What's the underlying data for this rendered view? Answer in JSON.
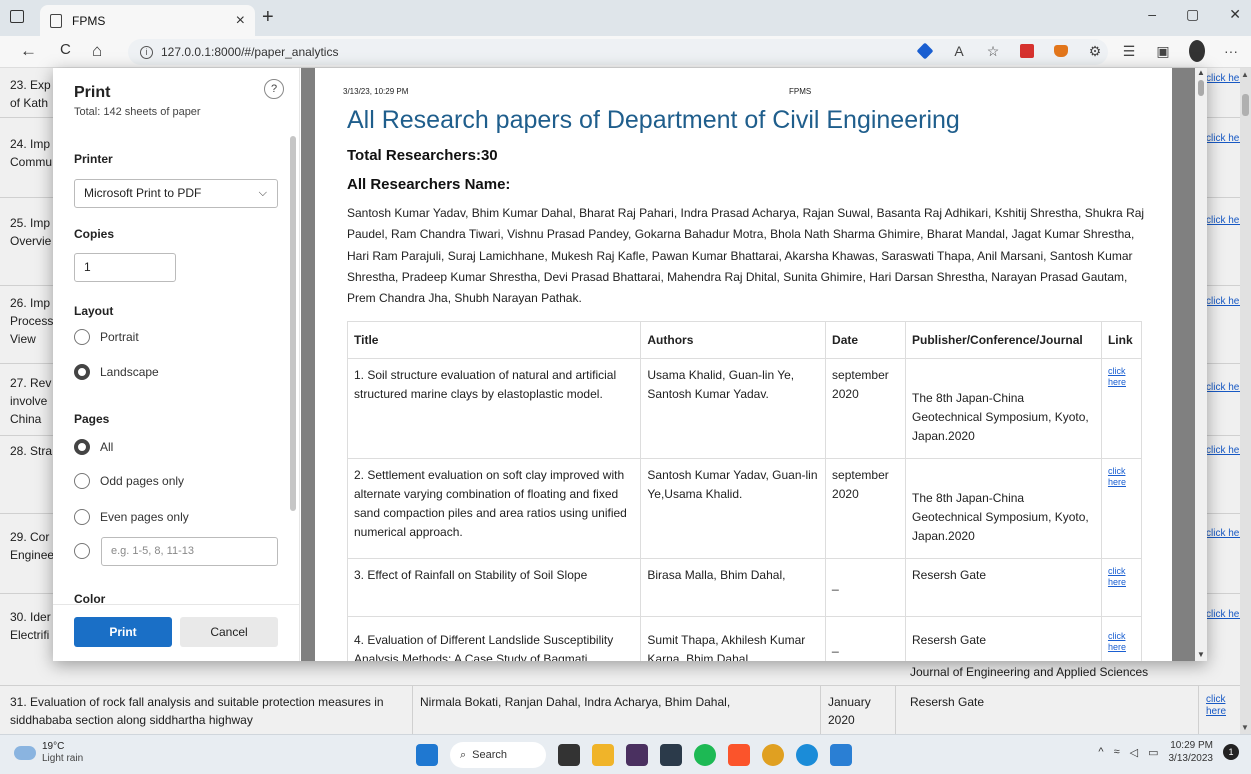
{
  "browser": {
    "tab_title": "FPMS",
    "tab_close": "×",
    "new_tab": "+",
    "url": "127.0.0.1:8000/#/paper_analytics",
    "back": "←",
    "refresh": "C",
    "home": "⌂",
    "win_min": "–",
    "win_max": "▢",
    "win_close": "✕",
    "more": "···"
  },
  "background_rows": [
    {
      "text": "23. Exp\nof Kath"
    },
    {
      "text": "24. Imp\nCommu"
    },
    {
      "text": "25. Imp\nOvervie"
    },
    {
      "text": "26. Imp\nProcess\nView"
    },
    {
      "text": "27. Rev\ninvolve\nChina"
    },
    {
      "text": "28. Stra"
    },
    {
      "text": "29. Cor\nEnginee"
    },
    {
      "text": "30. Ider\nElectrifi"
    }
  ],
  "background_link": "click here",
  "background_bottom_row": {
    "title": "31. Evaluation of rock fall analysis and suitable protection measures in siddhababa section along siddhartha highway",
    "authors": "Nirmala Bokati, Ranjan Dahal, Indra Acharya, Bhim Dahal,",
    "date": "January 2020",
    "publisher": "Resersh Gate",
    "link": "click here",
    "peek_text": "Journal of Engineering and Applied Sciences"
  },
  "print_dialog": {
    "title": "Print",
    "sheets": "Total: 142 sheets of paper",
    "help": "?",
    "printer_label": "Printer",
    "printer_value": "Microsoft Print to PDF",
    "copies_label": "Copies",
    "copies_value": "1",
    "layout_label": "Layout",
    "layout_options": [
      "Portrait",
      "Landscape"
    ],
    "layout_selected": "Landscape",
    "pages_label": "Pages",
    "pages_options": [
      "All",
      "Odd pages only",
      "Even pages only"
    ],
    "pages_selected": "All",
    "pages_range_placeholder": "e.g. 1-5, 8, 11-13",
    "color_label": "Color",
    "print_button": "Print",
    "cancel_button": "Cancel"
  },
  "preview": {
    "header_date": "3/13/23, 10:29 PM",
    "header_title": "FPMS",
    "heading": "All Research papers of Department of Civil Engineering",
    "total_researchers": "Total Researchers:30",
    "names_heading": "All Researchers Name:",
    "names": "Santosh Kumar Yadav, Bhim Kumar Dahal, Bharat Raj Pahari, Indra Prasad Acharya, Rajan Suwal, Basanta Raj Adhikari, Kshitij Shrestha, Shukra Raj Paudel, Ram Chandra Tiwari, Vishnu Prasad Pandey, Gokarna Bahadur Motra, Bhola Nath Sharma Ghimire, Bharat Mandal, Jagat Kumar Shrestha, Hari Ram Parajuli, Suraj Lamichhane, Mukesh Raj Kafle, Pawan Kumar Bhattarai, Akarsha Khawas, Saraswati Thapa, Anil Marsani, Santosh Kumar Shrestha, Pradeep Kumar Shrestha, Devi Prasad Bhattarai, Mahendra Raj Dhital, Sunita Ghimire, Hari Darsan Shrestha, Narayan Prasad Gautam, Prem Chandra Jha, Shubh Narayan Pathak.",
    "table_headers": [
      "Title",
      "Authors",
      "Date",
      "Publisher/Conference/Journal",
      "Link"
    ],
    "rows": [
      {
        "title": "1. Soil structure evaluation of natural and artificial structured marine clays by elastoplastic model.",
        "authors": "Usama Khalid, Guan-lin Ye, Santosh Kumar Yadav.",
        "date": "september 2020",
        "publisher": "The 8th Japan-China Geotechnical Symposium, Kyoto, Japan.2020",
        "link": "click here"
      },
      {
        "title": "2. Settlement evaluation on soft clay improved with alternate varying combination of floating and fixed sand compaction piles and area ratios using unified numerical approach.",
        "authors": "Santosh Kumar Yadav, Guan-lin Ye,Usama Khalid.",
        "date": "september 2020",
        "publisher": "The 8th Japan-China Geotechnical Symposium, Kyoto, Japan.2020",
        "link": "click here"
      },
      {
        "title": "3. Effect of Rainfall on Stability of Soil Slope",
        "authors": "Birasa Malla, Bhim Dahal,",
        "date": "_",
        "publisher": "Resersh Gate",
        "link": "click here"
      },
      {
        "title": "4. Evaluation of Different Landslide Susceptibility Analysis Methods: A Case Study of Bagmati",
        "authors": "Sumit Thapa, Akhilesh Kumar Karna, Bhim Dahal",
        "date": "_",
        "publisher": "Resersh Gate",
        "link": "click here"
      }
    ]
  },
  "taskbar": {
    "temp": "19°C",
    "weather": "Light rain",
    "search": "Search",
    "time": "10:29 PM",
    "date": "3/13/2023",
    "notif": "1"
  }
}
